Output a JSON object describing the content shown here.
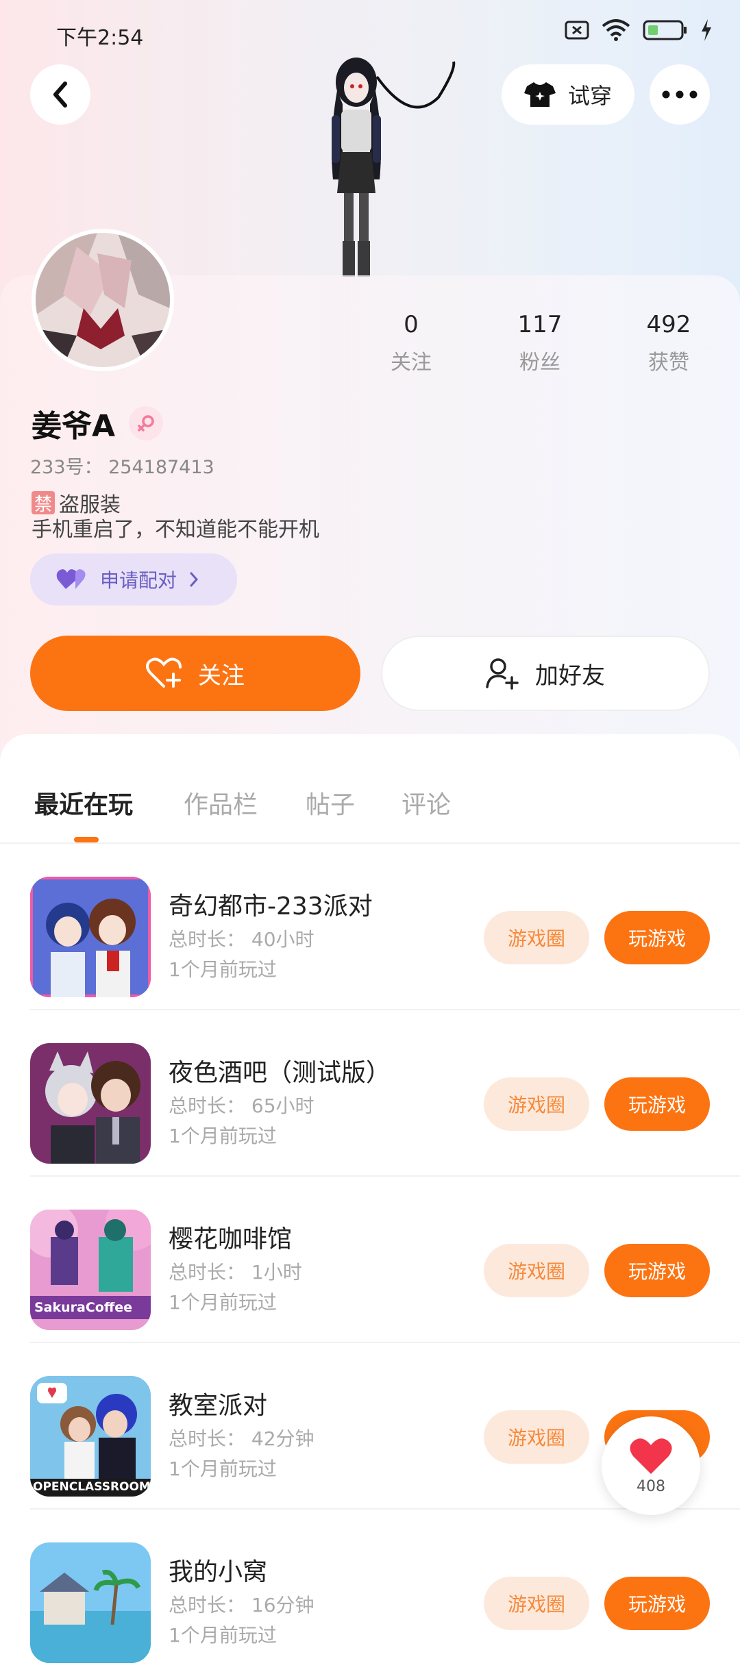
{
  "status_bar": {
    "time": "下午2:54"
  },
  "header": {
    "try_on_label": "试穿"
  },
  "profile": {
    "stats": [
      {
        "value": "0",
        "label": "关注"
      },
      {
        "value": "117",
        "label": "粉丝"
      },
      {
        "value": "492",
        "label": "获赞"
      }
    ],
    "name": "姜爷A",
    "uid": "233号： 254187413",
    "ban_tag": "禁",
    "ban_text": "盗服装",
    "bio": "手机重启了，不知道能不能开机",
    "match_label": "申请配对"
  },
  "actions": {
    "follow_label": "关注",
    "add_friend_label": "加好友"
  },
  "tabs": [
    "最近在玩",
    "作品栏",
    "帖子",
    "评论"
  ],
  "game_button_labels": {
    "circle": "游戏圈",
    "play": "玩游戏"
  },
  "games": [
    {
      "title": "奇幻都市-233派对",
      "duration": "总时长： 40小时",
      "last_played": "1个月前玩过"
    },
    {
      "title": "夜色酒吧（测试版）",
      "duration": "总时长： 65小时",
      "last_played": "1个月前玩过"
    },
    {
      "title": "樱花咖啡馆",
      "duration": "总时长： 1小时",
      "last_played": "1个月前玩过"
    },
    {
      "title": "教室派对",
      "duration": "总时长： 42分钟",
      "last_played": "1个月前玩过"
    },
    {
      "title": "我的小窝",
      "duration": "总时长： 16分钟",
      "last_played": "1个月前玩过"
    }
  ],
  "fab": {
    "count": "408"
  },
  "colors": {
    "accent": "#fc7412",
    "accent_light": "#fde9dc",
    "match_bg": "#e8e1f8"
  }
}
